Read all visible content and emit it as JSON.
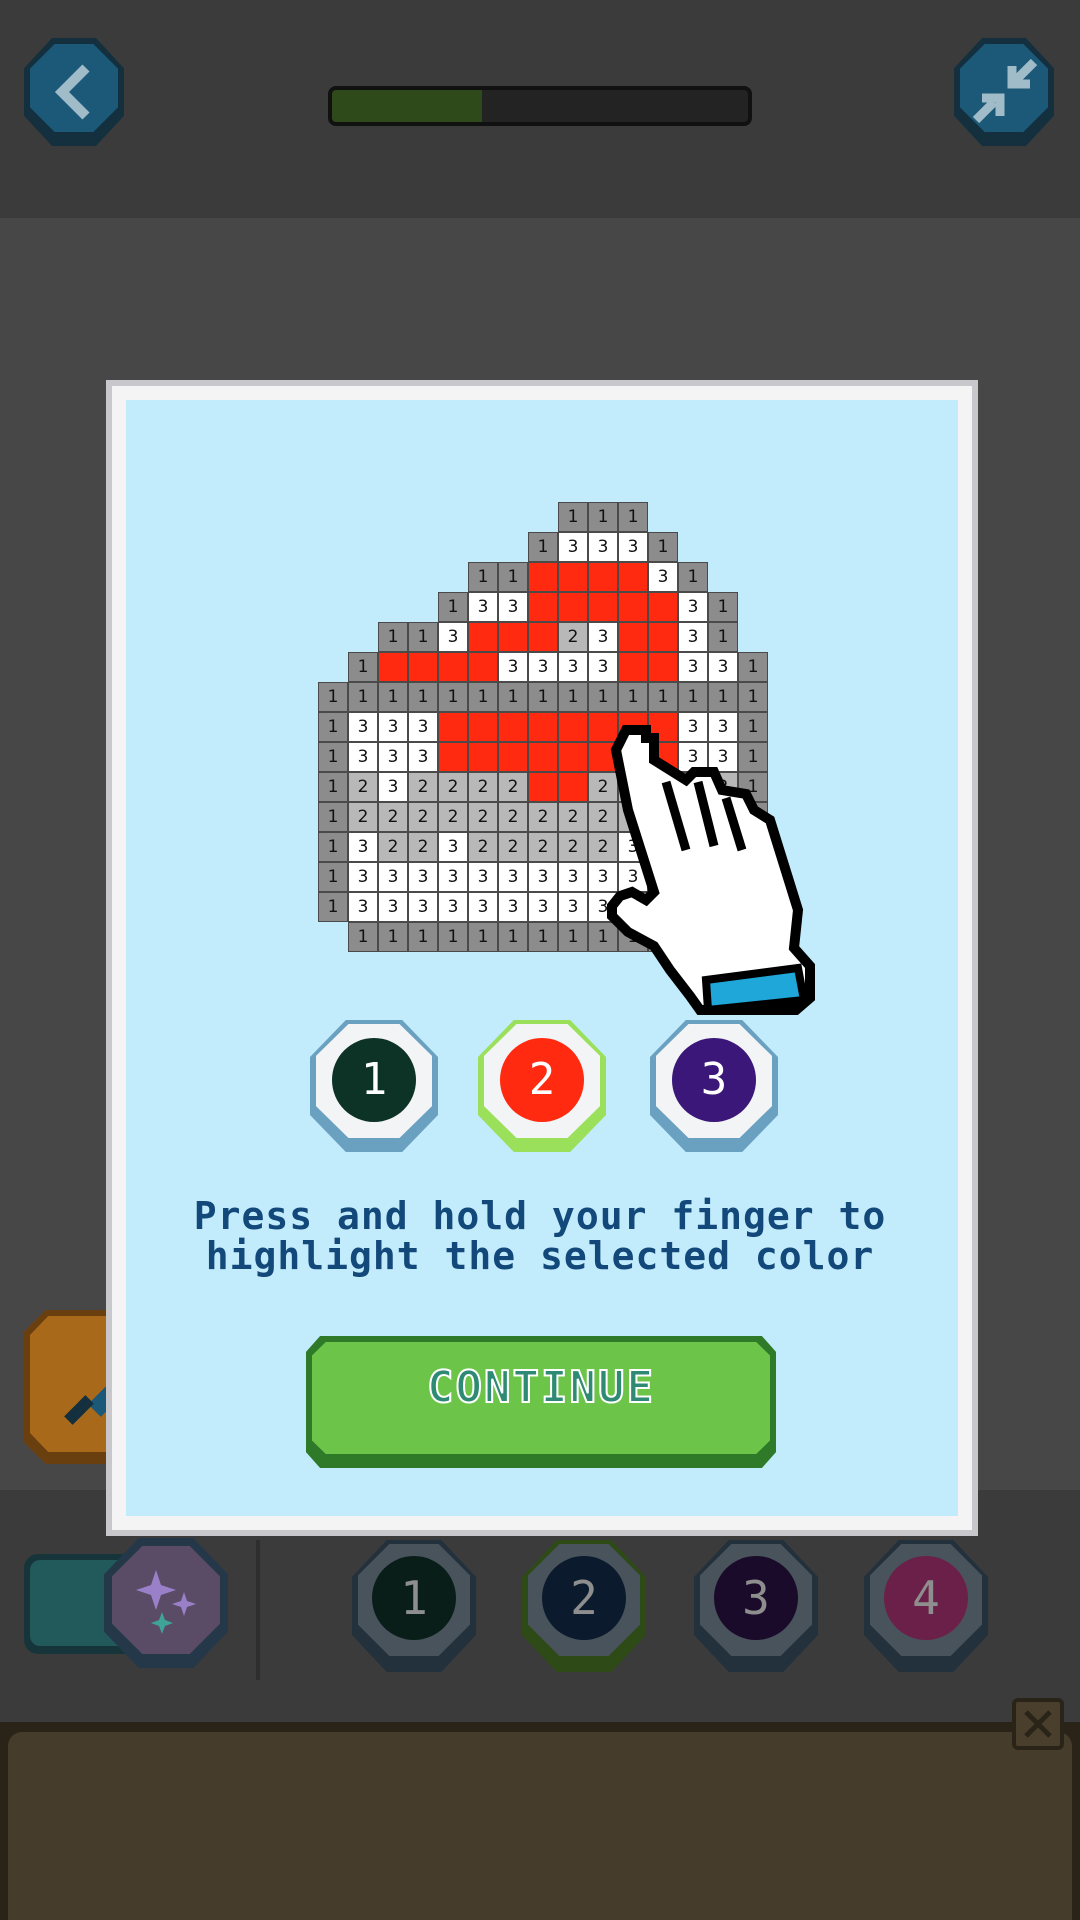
{
  "progress": {
    "fraction": 0.36,
    "fill_color": "#2f4a1a"
  },
  "header": {
    "back_icon": "chevron-left-icon",
    "collapse_icon": "collapse-arrows-icon"
  },
  "tool": {
    "brush_icon": "paint-brush-icon",
    "magic_icon": "sparkles-icon"
  },
  "palette": [
    {
      "label": "1",
      "color": "#0a1e19",
      "selected": false
    },
    {
      "label": "2",
      "color": "#0b1a2d",
      "selected": true
    },
    {
      "label": "3",
      "color": "#1b0b2a",
      "selected": false
    },
    {
      "label": "4",
      "color": "#6a2048",
      "selected": false
    }
  ],
  "drawer": {
    "close_icon": "close-x-icon"
  },
  "tutorial": {
    "grid": [
      "........111....",
      ".......13331...",
      ".....11RRRR31..",
      "....133RRRRR31.",
      "..113RRR23RR31.",
      ".1RRRR3333RR331",
      "111111111111111",
      "1333RRRRRRRR331",
      "1333RRRRRRRR331",
      "1232222RR222221",
      "122222222222221",
      "132232222232221",
      "133333333333331",
      "133333333333331",
      ".1111111111111."
    ],
    "swatches": [
      {
        "label": "1",
        "color": "#0c3325",
        "selected": false
      },
      {
        "label": "2",
        "color": "#ff2a10",
        "selected": true
      },
      {
        "label": "3",
        "color": "#3a1778",
        "selected": false
      }
    ],
    "instruction": "Press and hold your finger to highlight the selected color",
    "continue_label": "CONTINUE",
    "hand_icon": "pointing-hand-icon"
  }
}
